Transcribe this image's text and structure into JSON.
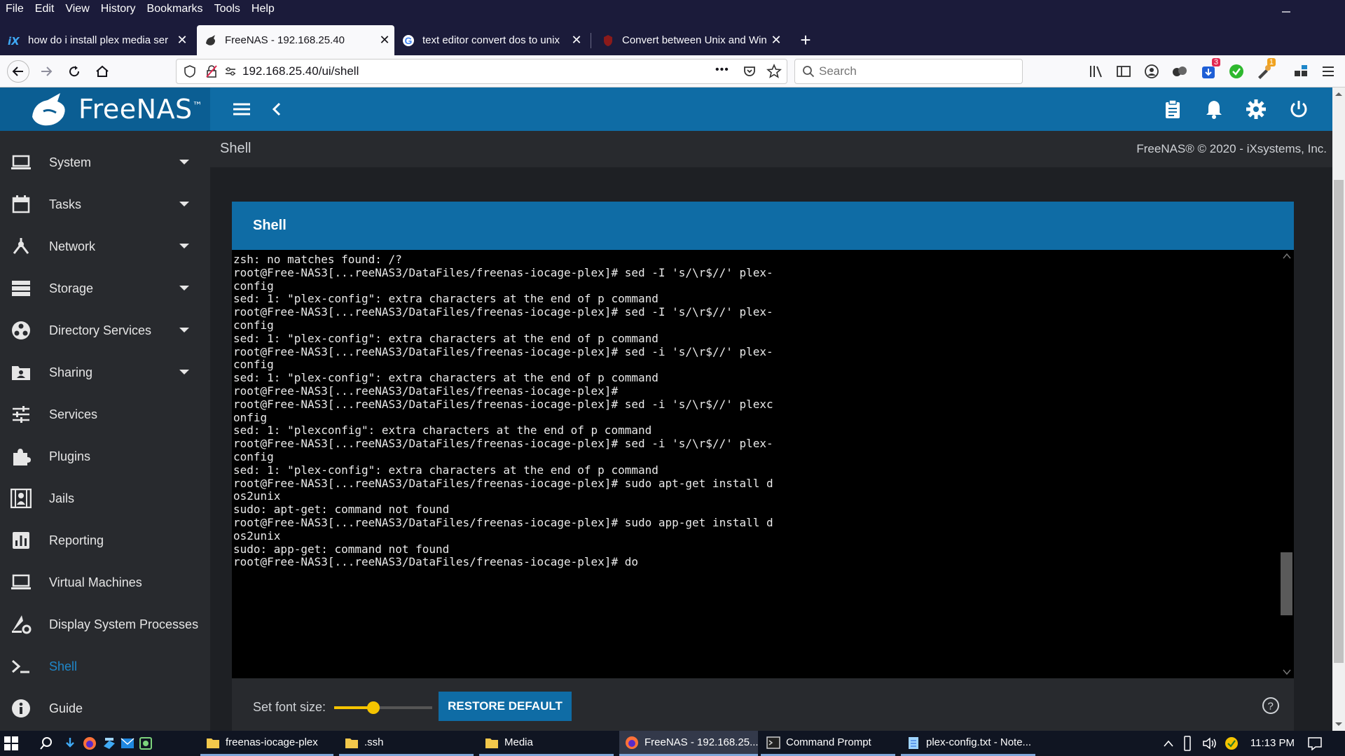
{
  "browser": {
    "menu": [
      "File",
      "Edit",
      "View",
      "History",
      "Bookmarks",
      "Tools",
      "Help"
    ],
    "tabs": [
      {
        "title": "how do i install plex media ser",
        "close": "✕"
      },
      {
        "title": "FreeNAS - 192.168.25.40",
        "close": "✕"
      },
      {
        "title": "text editor convert dos to unix",
        "close": "✕"
      },
      {
        "title": "Convert between Unix and Win",
        "close": "✕"
      }
    ],
    "new_tab": "+",
    "url": "192.168.25.40/ui/shell",
    "search_placeholder": "Search",
    "more_actions": "•••",
    "badges": {
      "extension_a": "3",
      "extension_b": "1"
    },
    "accent": "#0f6ca5"
  },
  "app": {
    "logo": "FreeNAS",
    "logo_mark": "™",
    "sidebar": [
      {
        "label": "System",
        "icon": "laptop-icon",
        "expandable": true
      },
      {
        "label": "Tasks",
        "icon": "calendar-icon",
        "expandable": true
      },
      {
        "label": "Network",
        "icon": "network-icon",
        "expandable": true
      },
      {
        "label": "Storage",
        "icon": "storage-icon",
        "expandable": true
      },
      {
        "label": "Directory Services",
        "icon": "directory-icon",
        "expandable": true
      },
      {
        "label": "Sharing",
        "icon": "sharing-icon",
        "expandable": true
      },
      {
        "label": "Services",
        "icon": "sliders-icon",
        "expandable": false
      },
      {
        "label": "Plugins",
        "icon": "puzzle-icon",
        "expandable": false
      },
      {
        "label": "Jails",
        "icon": "jail-icon",
        "expandable": false
      },
      {
        "label": "Reporting",
        "icon": "chart-icon",
        "expandable": false
      },
      {
        "label": "Virtual Machines",
        "icon": "monitor-icon",
        "expandable": false
      },
      {
        "label": "Display System Processes",
        "icon": "processes-icon",
        "expandable": false
      },
      {
        "label": "Shell",
        "icon": "terminal-icon",
        "expandable": false,
        "active": true
      },
      {
        "label": "Guide",
        "icon": "info-icon",
        "expandable": false
      }
    ],
    "page_title": "Shell",
    "copyright": "FreeNAS® © 2020 - iXsystems, Inc.",
    "card_title": "Shell",
    "terminal_lines": [
      "zsh: no matches found: /?",
      "root@Free-NAS3[...reeNAS3/DataFiles/freenas-iocage-plex]# sed -I 's/\\r$//' plex-",
      "config",
      "sed: 1: \"plex-config\": extra characters at the end of p command",
      "root@Free-NAS3[...reeNAS3/DataFiles/freenas-iocage-plex]# sed -I 's/\\r$//' plex-",
      "config",
      "sed: 1: \"plex-config\": extra characters at the end of p command",
      "root@Free-NAS3[...reeNAS3/DataFiles/freenas-iocage-plex]# sed -i 's/\\r$//' plex-",
      "config",
      "sed: 1: \"plex-config\": extra characters at the end of p command",
      "root@Free-NAS3[...reeNAS3/DataFiles/freenas-iocage-plex]#",
      "root@Free-NAS3[...reeNAS3/DataFiles/freenas-iocage-plex]# sed -i 's/\\r$//' plexc",
      "onfig",
      "sed: 1: \"plexconfig\": extra characters at the end of p command",
      "root@Free-NAS3[...reeNAS3/DataFiles/freenas-iocage-plex]# sed -i 's/\\r$//' plex-",
      "config",
      "sed: 1: \"plex-config\": extra characters at the end of p command",
      "root@Free-NAS3[...reeNAS3/DataFiles/freenas-iocage-plex]# sudo apt-get install d",
      "os2unix",
      "sudo: apt-get: command not found",
      "root@Free-NAS3[...reeNAS3/DataFiles/freenas-iocage-plex]# sudo app-get install d",
      "os2unix",
      "sudo: app-get: command not found",
      "root@Free-NAS3[...reeNAS3/DataFiles/freenas-iocage-plex]# do"
    ],
    "font_size_label": "Set font size:",
    "font_size_fraction": 0.4,
    "restore_button": "RESTORE DEFAULT",
    "help": "?"
  },
  "taskbar": {
    "items": [
      {
        "label": "freenas-iocage-plex",
        "icon": "folder-icon"
      },
      {
        "label": ".ssh",
        "icon": "folder-icon"
      },
      {
        "label": "Media",
        "icon": "folder-icon"
      },
      {
        "label": "FreeNAS - 192.168.25....",
        "icon": "firefox-icon"
      },
      {
        "label": "Command Prompt",
        "icon": "cmd-icon"
      },
      {
        "label": "plex-config.txt - Note...",
        "icon": "notepad-icon"
      }
    ],
    "clock": "11:13 PM"
  }
}
